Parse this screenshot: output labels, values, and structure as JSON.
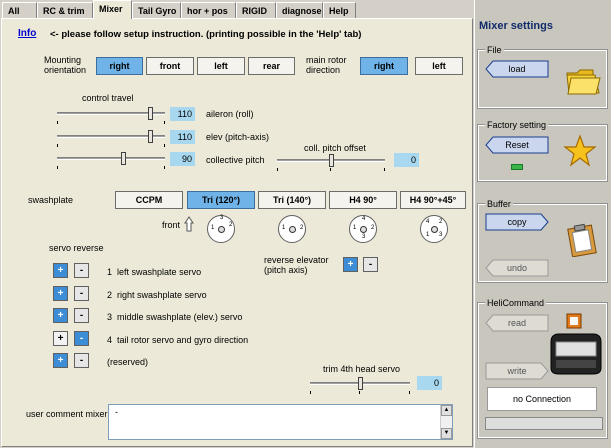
{
  "tabs": [
    "All",
    "RC & trim",
    "Mixer",
    "Tail Gyro",
    "hor + pos",
    "RIGID",
    "diagnose",
    "Help"
  ],
  "active_tab": "Mixer",
  "info_link": "Info",
  "instruction": "<- please follow setup instruction. (printing possible in the 'Help' tab)",
  "mounting": {
    "label_line1": "Mounting",
    "label_line2": "orientation",
    "options": [
      "right",
      "front",
      "left",
      "rear"
    ],
    "selected": "right"
  },
  "main_rotor": {
    "label_line1": "main rotor",
    "label_line2": "direction",
    "options": [
      "right",
      "left"
    ],
    "selected": "right"
  },
  "control_travel": {
    "label": "control travel",
    "aileron": {
      "value": "110",
      "label": "aileron (roll)",
      "level": 0.88
    },
    "elev": {
      "value": "110",
      "label": "elev (pitch-axis)",
      "level": 0.88
    },
    "collective": {
      "value": "90",
      "label": "collective pitch",
      "level": 0.62
    }
  },
  "coll_pitch_offset": {
    "label": "coll. pitch offset",
    "value": "0",
    "level": 0.5
  },
  "swashplate": {
    "label": "swashplate",
    "options": [
      "CCPM",
      "Tri (120°)",
      "Tri (140°)",
      "H4 90°",
      "H4 90°+45°"
    ],
    "selected": "Tri (120°)",
    "front_label": "front"
  },
  "servo_reverse": {
    "label": "servo reverse",
    "servos": [
      {
        "num": "1",
        "label": "left swashplate servo"
      },
      {
        "num": "2",
        "label": "right swashplate servo"
      },
      {
        "num": "3",
        "label": "middle swashplate (elev.) servo"
      },
      {
        "num": "4",
        "label": "tail rotor servo and gyro direction"
      },
      {
        "num": "",
        "label": "(reserved)"
      }
    ],
    "plus": "+",
    "minus": "-"
  },
  "reverse_elevator": {
    "label_line1": "reverse elevator",
    "label_line2": "(pitch axis)"
  },
  "trim_4th": {
    "label": "trim 4th head servo",
    "value": "0",
    "level": 0.5
  },
  "user_comment": {
    "label": "user comment mixer",
    "value": "-"
  },
  "sidebar": {
    "title": "Mixer settings",
    "file": {
      "label": "File",
      "load": "load"
    },
    "factory": {
      "label": "Factory setting",
      "reset": "Reset"
    },
    "buffer": {
      "label": "Buffer",
      "copy": "copy",
      "undo": "undo"
    },
    "helicommand": {
      "label": "HeliCommand",
      "read": "read",
      "write": "write",
      "status": "no Connection"
    }
  },
  "colors": {
    "selected_button": "#6fb3e8",
    "value_box": "#a8d8f0",
    "plus_button": "#3c8dd6"
  }
}
